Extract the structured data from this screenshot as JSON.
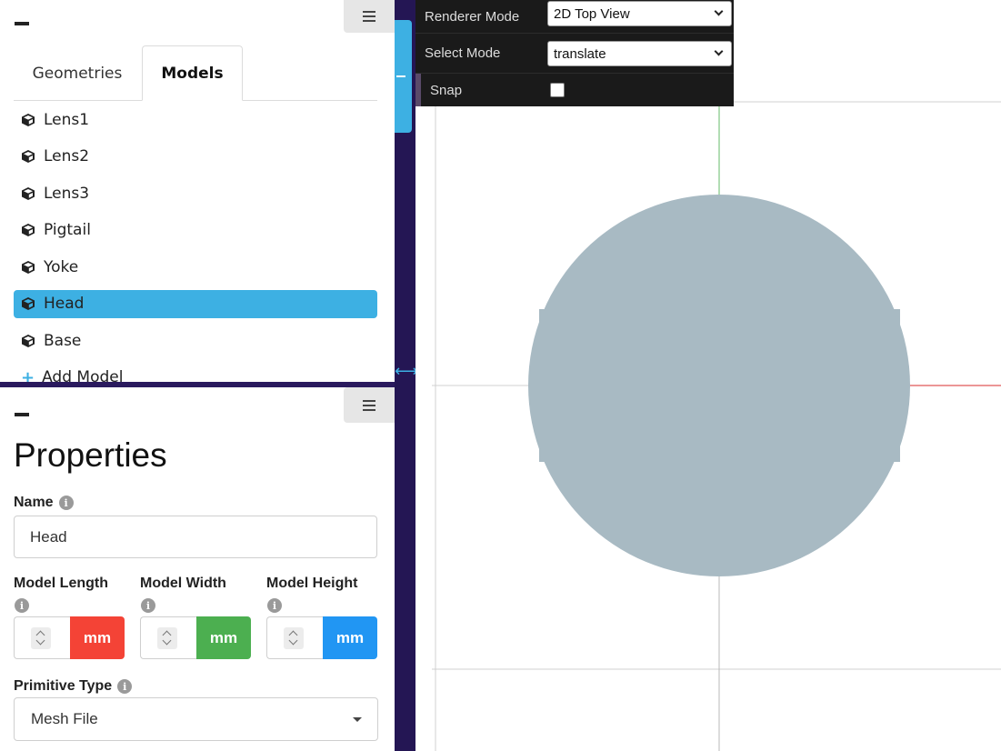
{
  "models_panel": {
    "tabs": [
      "Geometries",
      "Models"
    ],
    "active_tab": "Models",
    "items": [
      {
        "label": "Lens1"
      },
      {
        "label": "Lens2"
      },
      {
        "label": "Lens3"
      },
      {
        "label": "Pigtail"
      },
      {
        "label": "Yoke"
      },
      {
        "label": "Head",
        "selected": true
      },
      {
        "label": "Base"
      }
    ],
    "add_label": "Add Model"
  },
  "properties": {
    "title": "Properties",
    "name_label": "Name",
    "name_value": "Head",
    "length_label": "Model Length",
    "width_label": "Model Width",
    "height_label": "Model Height",
    "unit": "mm",
    "unit_colors": [
      "#f44336",
      "#4caf50",
      "#2196f3"
    ],
    "primitive_label": "Primitive Type",
    "primitive_value": "Mesh File"
  },
  "controls": {
    "renderer_label": "Renderer Mode",
    "renderer_value": "2D Top View",
    "select_label": "Select Mode",
    "select_value": "translate",
    "snap_label": "Snap",
    "snap_checked": false
  },
  "colors": {
    "accent": "#3db0e3",
    "sidebar_dark": "#241654",
    "model_fill": "#a8bac3",
    "axis_x": "#e57373",
    "axis_y": "#66bb6a"
  }
}
